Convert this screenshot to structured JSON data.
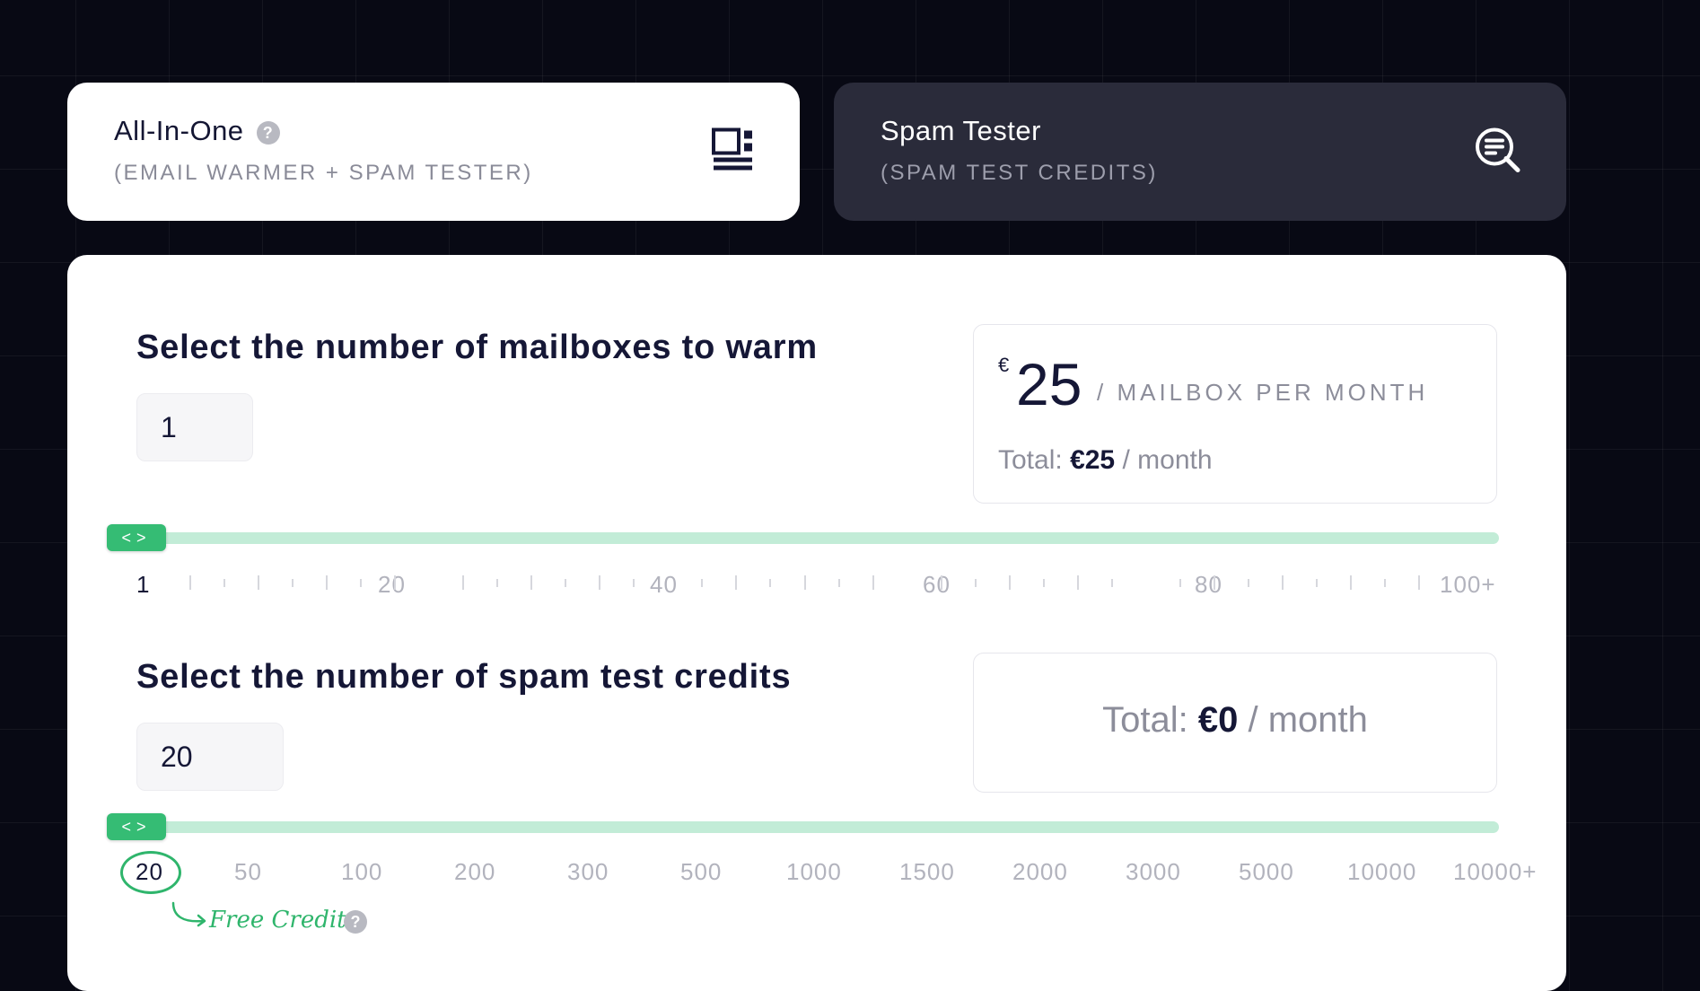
{
  "tabs": [
    {
      "title": "All-In-One",
      "subtitle": "(EMAIL WARMER + SPAM TESTER)",
      "icon": "dashboard-icon",
      "active": true
    },
    {
      "title": "Spam Tester",
      "subtitle": "(SPAM TEST CREDITS)",
      "icon": "search-document-icon",
      "active": false
    }
  ],
  "help_glyph": "?",
  "mailboxes": {
    "title": "Select the number of mailboxes to warm",
    "value": "1",
    "price_currency": "€",
    "price": "25",
    "per_label": "/ MAILBOX PER MONTH",
    "total_label": "Total:",
    "total_amount": "€25",
    "total_suffix": "/ month",
    "slider_value": 1,
    "ticks": [
      "1",
      "20",
      "40",
      "60",
      "80",
      "100+"
    ]
  },
  "credits": {
    "title": "Select the number of spam test credits",
    "value": "20",
    "total_label": "Total:",
    "total_amount": "€0",
    "total_suffix": "/ month",
    "slider_value": 20,
    "ticks": [
      "20",
      "50",
      "100",
      "200",
      "300",
      "500",
      "1000",
      "1500",
      "2000",
      "3000",
      "5000",
      "10000",
      "10000+"
    ],
    "free_label": "Free Credits"
  },
  "colors": {
    "accent": "#35bc74",
    "track": "#c2ecd7",
    "background": "#080914",
    "inactive_tab": "#2a2b3a"
  }
}
